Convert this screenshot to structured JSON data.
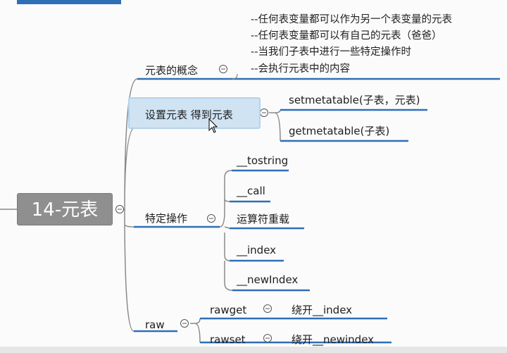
{
  "root": {
    "label": "14-元表"
  },
  "branches": [
    {
      "label": "元表的概念",
      "notes": [
        "--任何表变量都可以作为另一个表变量的元表",
        "--任何表变量都可以有自己的元表（爸爸）",
        "--当我们子表中进行一些特定操作时",
        "--会执行元表中的内容"
      ]
    },
    {
      "label": "设置元表 得到元表",
      "children": [
        "setmetatable(子表，元表)",
        "getmetatable(子表)"
      ]
    },
    {
      "label": "特定操作",
      "children": [
        "__tostring",
        "__call",
        "运算符重载",
        "__index",
        "__newIndex"
      ]
    },
    {
      "label": "raw",
      "children": [
        {
          "label": "rawget",
          "child": "绕开__index"
        },
        {
          "label": "rawset",
          "child": "绕开__newindex"
        }
      ]
    }
  ],
  "colors": {
    "branch_line": "#2f6fb8",
    "connector": "#8a8a8a",
    "root_fill": "#8f8f8f",
    "selected_fill": "#cfe3f3"
  },
  "icons": [
    "collapse-icon",
    "mouse-cursor-icon"
  ]
}
